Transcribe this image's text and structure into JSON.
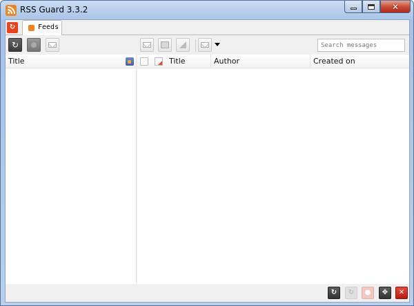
{
  "window": {
    "title": "RSS Guard 3.3.2",
    "icon": "rss-icon",
    "controls": [
      "minimize-icon",
      "maximize-icon",
      "close-icon"
    ]
  },
  "tabs": [
    {
      "label": "Feeds",
      "icon": "rss-icon",
      "active": true
    }
  ],
  "toolbar": {
    "left_buttons": [
      "refresh-icon",
      "stop-icon",
      "mark-read-icon"
    ],
    "message_buttons": [
      "mark-read-icon",
      "mark-unread-icon",
      "important-icon",
      "mark-all-icon"
    ],
    "search_placeholder": "Search messages"
  },
  "feeds_pane": {
    "columns": [
      "Title"
    ]
  },
  "messages_pane": {
    "columns": [
      "Title",
      "Author",
      "Created on"
    ]
  },
  "statusbar": {
    "buttons": [
      "refresh-icon",
      "refresh-icon",
      "stop-icon",
      "move-icon",
      "close-icon"
    ]
  },
  "colors": {
    "accent": "#f08422",
    "close": "#c75036",
    "frame": "#a7c2e6"
  }
}
